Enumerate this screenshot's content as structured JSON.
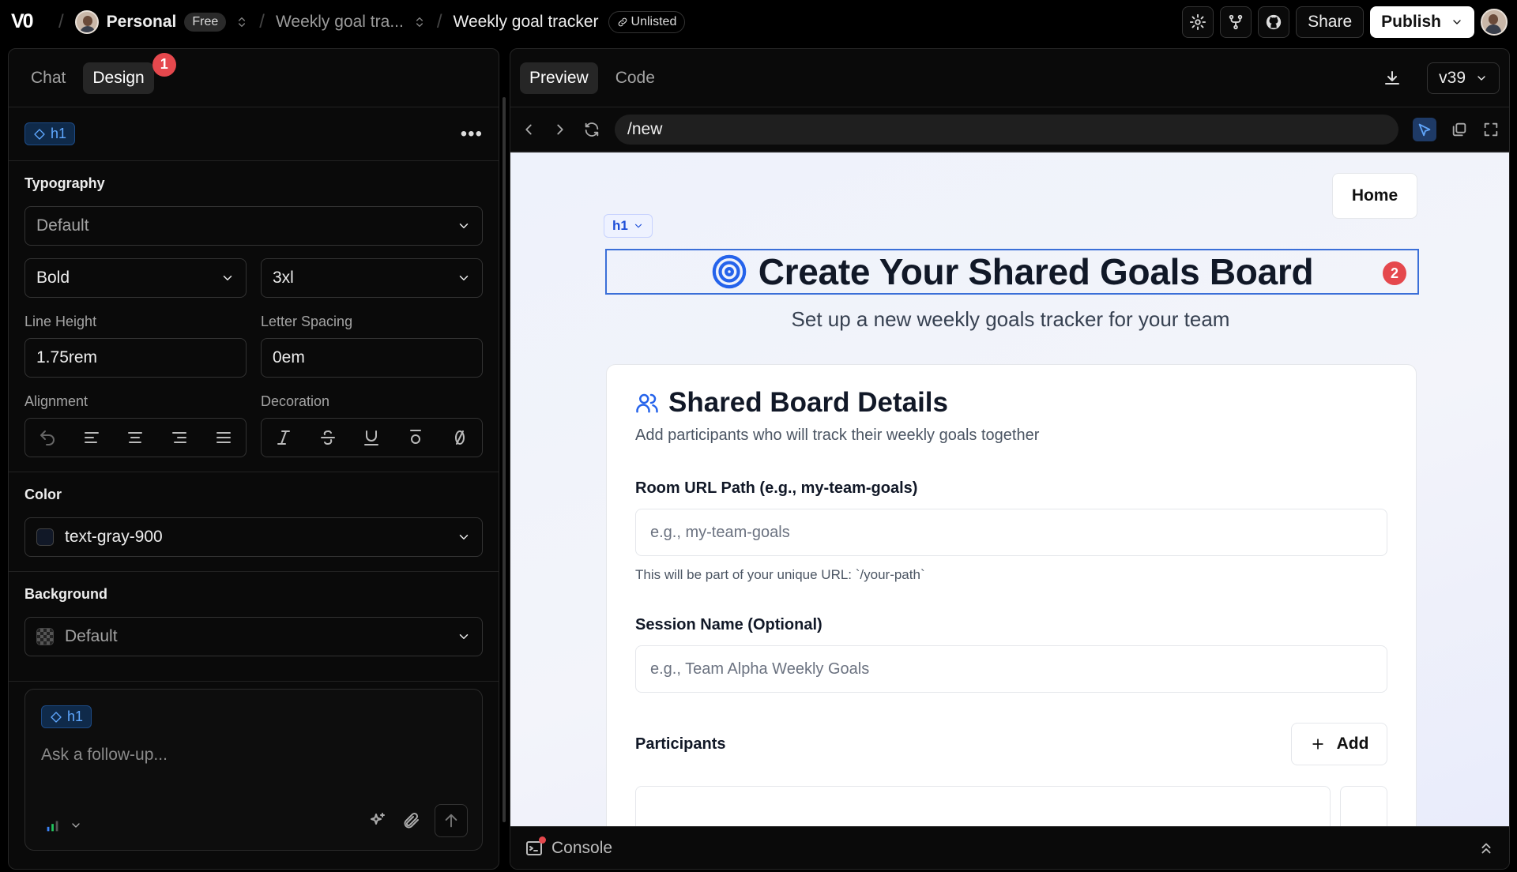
{
  "topbar": {
    "logo": "V0",
    "workspace": "Personal",
    "plan_badge": "Free",
    "project_short": "Weekly goal tra...",
    "chat_title": "Weekly goal tracker",
    "visibility": "Unlisted",
    "share_label": "Share",
    "publish_label": "Publish"
  },
  "left_panel": {
    "tabs": [
      {
        "label": "Chat"
      },
      {
        "label": "Design"
      }
    ],
    "design_badge": "1",
    "selected_element": "h1",
    "typography": {
      "title": "Typography",
      "font_family": "Default",
      "font_weight": "Bold",
      "font_size": "3xl",
      "line_height_label": "Line Height",
      "line_height": "1.75rem",
      "letter_spacing_label": "Letter Spacing",
      "letter_spacing": "0em",
      "alignment_label": "Alignment",
      "decoration_label": "Decoration"
    },
    "color": {
      "title": "Color",
      "value": "text-gray-900",
      "swatch": "#111827"
    },
    "background": {
      "title": "Background",
      "value": "Default"
    },
    "composer": {
      "tag": "h1",
      "placeholder": "Ask a follow-up..."
    }
  },
  "right_panel": {
    "tabs": [
      {
        "label": "Preview"
      },
      {
        "label": "Code"
      }
    ],
    "version": "v39",
    "url": "/new",
    "console_label": "Console"
  },
  "preview": {
    "home_button": "Home",
    "h1_chip": "h1",
    "heading": "Create Your Shared Goals Board",
    "heading_badge": "2",
    "subtitle": "Set up a new weekly goals tracker for your team",
    "card": {
      "title": "Shared Board Details",
      "description": "Add participants who will track their weekly goals together",
      "room_label": "Room URL Path (e.g., my-team-goals)",
      "room_placeholder": "e.g., my-team-goals",
      "room_hint": "This will be part of your unique URL: `/your-path`",
      "session_label": "Session Name (Optional)",
      "session_placeholder": "e.g., Team Alpha Weekly Goals",
      "participants_label": "Participants",
      "add_label": "Add"
    }
  },
  "colors": {
    "accent": "#3b6fd8",
    "badge": "#e5484d",
    "heading": "#111827"
  }
}
